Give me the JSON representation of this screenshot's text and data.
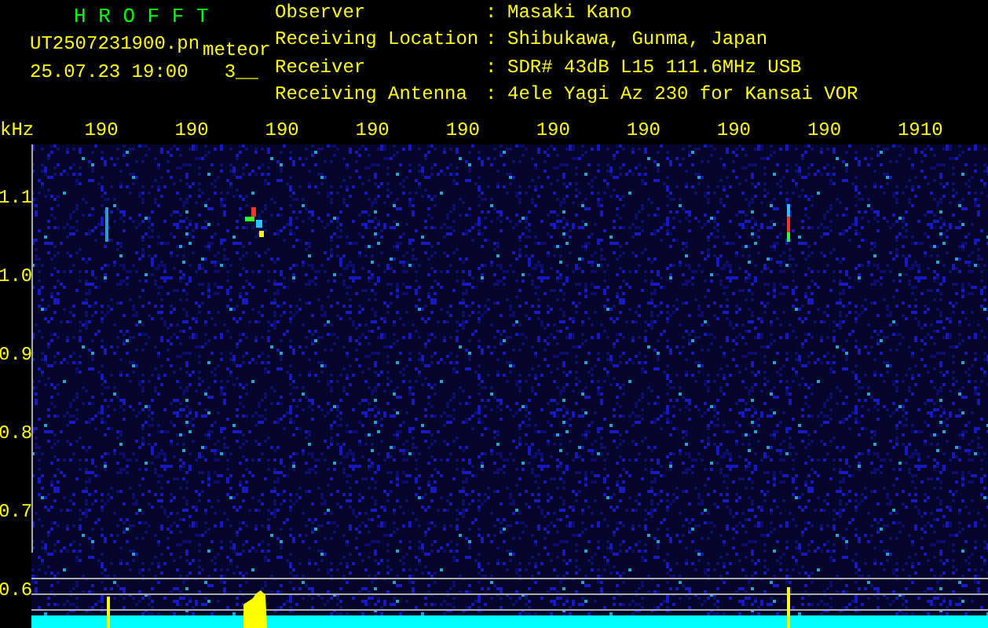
{
  "header": {
    "app_name": "H R O F F T",
    "file_name": "UT2507231900.pn",
    "event_type": "meteor",
    "timestamp": "25.07.23 19:00",
    "count": "3__"
  },
  "station_info": [
    {
      "label": "Observer",
      "value": "Masaki Kano",
      "sep": ":"
    },
    {
      "label": "Receiving Location",
      "value": "Shibukawa, Gunma, Japan",
      "sep": ":"
    },
    {
      "label": "Receiver",
      "value": "SDR# 43dB L15 111.6MHz USB",
      "sep": ":"
    },
    {
      "label": "Receiving Antenna",
      "value": "4ele Yagi Az 230 for Kansai VOR",
      "sep": ":"
    }
  ],
  "axis": {
    "unit": "kHz",
    "x_labels": [
      "190",
      "190",
      "190",
      "190",
      "190",
      "190",
      "190",
      "190",
      "190",
      "1910"
    ],
    "y_labels": [
      "1.1",
      "1.0",
      "0.9",
      "0.8",
      "0.7",
      "0.6"
    ]
  }
}
